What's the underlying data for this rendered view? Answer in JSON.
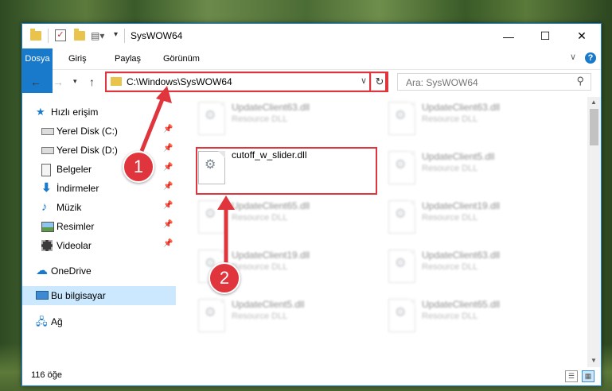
{
  "window": {
    "title": "SysWOW64"
  },
  "ribbon": {
    "tabs": [
      "Dosya",
      "Giriş",
      "Paylaş",
      "Görünüm"
    ],
    "help": "?"
  },
  "nav": {
    "address": "C:\\Windows\\SysWOW64",
    "search_placeholder": "Ara: SysWOW64"
  },
  "sidebar": {
    "items": [
      {
        "label": "Hızlı erişim",
        "icon": "star-icon"
      },
      {
        "label": "Yerel Disk (C:)",
        "icon": "drive-icon"
      },
      {
        "label": "Yerel Disk (D:)",
        "icon": "drive-icon"
      },
      {
        "label": "Belgeler",
        "icon": "documents-icon"
      },
      {
        "label": "İndirmeler",
        "icon": "download-icon"
      },
      {
        "label": "Müzik",
        "icon": "music-icon"
      },
      {
        "label": "Resimler",
        "icon": "pictures-icon"
      },
      {
        "label": "Videolar",
        "icon": "video-icon"
      },
      {
        "label": "OneDrive",
        "icon": "cloud-icon"
      },
      {
        "label": "Bu bilgisayar",
        "icon": "computer-icon"
      },
      {
        "label": "Ağ",
        "icon": "network-icon"
      }
    ]
  },
  "files": [
    {
      "name": "UpdateClient63.dll",
      "type": "Resource DLL"
    },
    {
      "name": "UpdateClient63.dll",
      "type": "Resource DLL"
    },
    {
      "name": "cutoff_w_slider.dll",
      "type": ""
    },
    {
      "name": "UpdateClient5.dll",
      "type": "Resource DLL"
    },
    {
      "name": "UpdateClient65.dll",
      "type": "Resource DLL"
    },
    {
      "name": "UpdateClient19.dll",
      "type": "Resource DLL"
    },
    {
      "name": "UpdateClient19.dll",
      "type": "Resource DLL"
    },
    {
      "name": "UpdateClient63.dll",
      "type": "Resource DLL"
    },
    {
      "name": "UpdateClient5.dll",
      "type": "Resource DLL"
    },
    {
      "name": "UpdateClient65.dll",
      "type": "Resource DLL"
    }
  ],
  "status": {
    "count": "116 öğe"
  },
  "annotations": {
    "step1": "1",
    "step2": "2"
  },
  "colors": {
    "accent": "#1979ca",
    "highlight_red": "#e0353d",
    "selection": "#cce8ff"
  }
}
